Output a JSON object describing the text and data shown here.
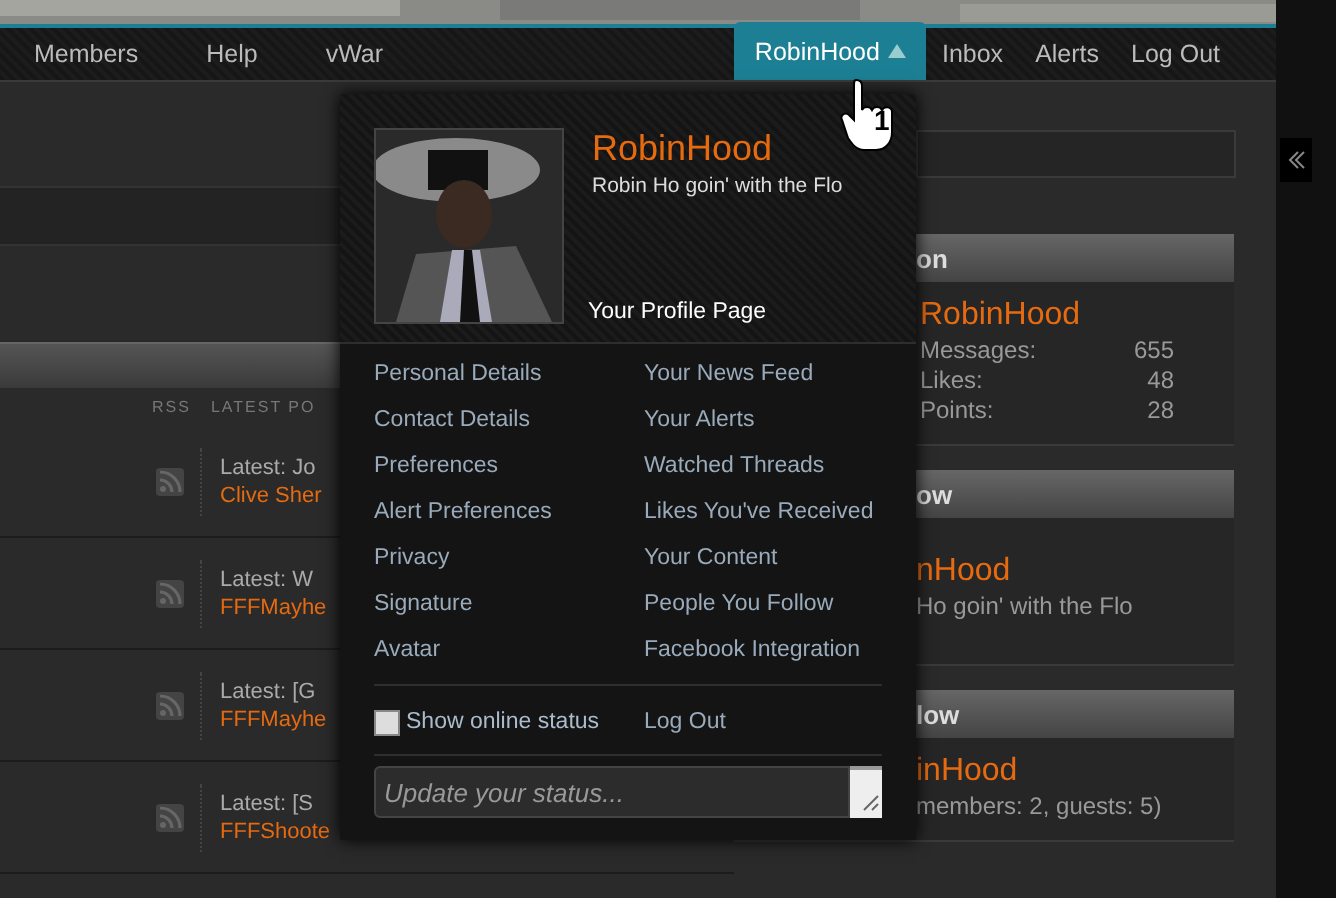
{
  "nav": {
    "left": [
      "Members",
      "Help",
      "vWar"
    ],
    "right": [
      {
        "label": "RobinHood",
        "selected": true
      },
      {
        "label": "Inbox",
        "selected": false
      },
      {
        "label": "Alerts",
        "selected": false
      },
      {
        "label": "Log Out",
        "selected": false
      }
    ]
  },
  "step_marker": "1",
  "forum": {
    "columns": [
      "RSS",
      "LATEST PO"
    ],
    "rows": [
      {
        "latest": "Latest: Jo",
        "author": "Clive Sher"
      },
      {
        "latest": "Latest: W",
        "author": "FFFMayhe"
      },
      {
        "latest": "Latest: [G",
        "author": "FFFMayhe"
      },
      {
        "latest": "Latest: [S",
        "author": "FFFShoote"
      }
    ]
  },
  "sidebar": {
    "panels": [
      {
        "heading": "on",
        "name": "RobinHood",
        "stats": [
          {
            "label": "Messages:",
            "value": "655"
          },
          {
            "label": "Likes:",
            "value": "48"
          },
          {
            "label": "Points:",
            "value": "28"
          }
        ]
      },
      {
        "heading": "ow",
        "name": "nHood",
        "status": "Ho goin' with the Flo"
      },
      {
        "heading": "low",
        "name": "inHood",
        "status": "members: 2, guests: 5)"
      }
    ]
  },
  "popup": {
    "username": "RobinHood",
    "status": "Robin Ho goin' with the Flo",
    "profile_link": "Your Profile Page",
    "left_links": [
      "Personal Details",
      "Contact Details",
      "Preferences",
      "Alert Preferences",
      "Privacy",
      "Signature",
      "Avatar"
    ],
    "right_links": [
      "Your News Feed",
      "Your Alerts",
      "Watched Threads",
      "Likes You've Received",
      "Your Content",
      "People You Follow",
      "Facebook Integration"
    ],
    "online_status": {
      "label": "Show online status",
      "checked": false
    },
    "logout": "Log Out",
    "status_field": {
      "placeholder": "Update your status..."
    }
  }
}
